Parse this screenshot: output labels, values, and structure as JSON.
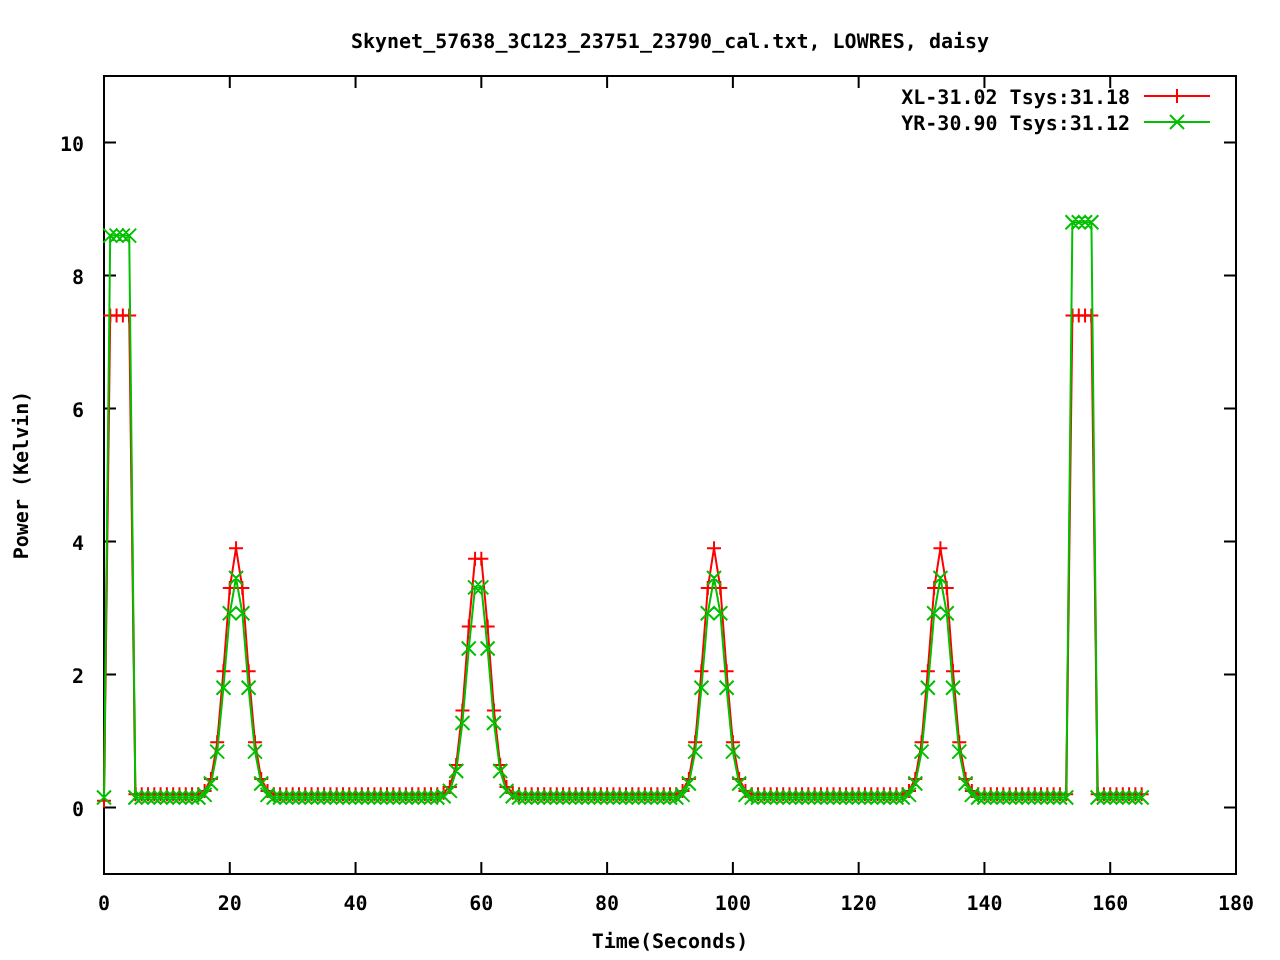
{
  "chart_data": {
    "type": "line",
    "title": "Skynet_57638_3C123_23751_23790_cal.txt, LOWRES, daisy",
    "xlabel": "Time(Seconds)",
    "ylabel": "Power (Kelvin)",
    "x": [
      0,
      1,
      2,
      3,
      4,
      5,
      6,
      7,
      8,
      9,
      10,
      11,
      12,
      13,
      14,
      15,
      16,
      17,
      18,
      19,
      20,
      21,
      22,
      23,
      24,
      25,
      26,
      27,
      28,
      29,
      30,
      31,
      32,
      33,
      34,
      35,
      36,
      37,
      38,
      39,
      40,
      41,
      42,
      43,
      44,
      45,
      46,
      47,
      48,
      49,
      50,
      51,
      52,
      53,
      54,
      55,
      56,
      57,
      58,
      59,
      60,
      61,
      62,
      63,
      64,
      65,
      66,
      67,
      68,
      69,
      70,
      71,
      72,
      73,
      74,
      75,
      76,
      77,
      78,
      79,
      80,
      81,
      82,
      83,
      84,
      85,
      86,
      87,
      88,
      89,
      90,
      91,
      92,
      93,
      94,
      95,
      96,
      97,
      98,
      99,
      100,
      101,
      102,
      103,
      104,
      105,
      106,
      107,
      108,
      109,
      110,
      111,
      112,
      113,
      114,
      115,
      116,
      117,
      118,
      119,
      120,
      121,
      122,
      123,
      124,
      125,
      126,
      127,
      128,
      129,
      130,
      131,
      132,
      133,
      134,
      135,
      136,
      137,
      138,
      139,
      140,
      141,
      142,
      143,
      144,
      145,
      146,
      147,
      148,
      149,
      150,
      151,
      152,
      153,
      154,
      155,
      156,
      157,
      158,
      159,
      160,
      161,
      162,
      163,
      164,
      165
    ],
    "series": [
      {
        "name": "XL-31.02 Tsys:31.18",
        "color": "#ff0000",
        "marker": "plus",
        "values": [
          0.1,
          7.4,
          7.4,
          7.4,
          7.4,
          0.2,
          0.2,
          0.2,
          0.2,
          0.2,
          0.2,
          0.2,
          0.2,
          0.2,
          0.2,
          0.2,
          0.25,
          0.43,
          0.98,
          2.05,
          3.3,
          3.9,
          3.3,
          2.05,
          0.98,
          0.43,
          0.25,
          0.2,
          0.2,
          0.2,
          0.2,
          0.2,
          0.2,
          0.2,
          0.2,
          0.2,
          0.2,
          0.2,
          0.2,
          0.2,
          0.2,
          0.2,
          0.2,
          0.2,
          0.2,
          0.2,
          0.2,
          0.2,
          0.2,
          0.2,
          0.2,
          0.2,
          0.2,
          0.2,
          0.22,
          0.31,
          0.64,
          1.46,
          2.72,
          3.74,
          3.74,
          2.72,
          1.46,
          0.64,
          0.31,
          0.22,
          0.2,
          0.2,
          0.2,
          0.2,
          0.2,
          0.2,
          0.2,
          0.2,
          0.2,
          0.2,
          0.2,
          0.2,
          0.2,
          0.2,
          0.2,
          0.2,
          0.2,
          0.2,
          0.2,
          0.2,
          0.2,
          0.2,
          0.2,
          0.2,
          0.2,
          0.2,
          0.25,
          0.43,
          0.98,
          2.05,
          3.3,
          3.9,
          3.3,
          2.05,
          0.98,
          0.43,
          0.25,
          0.2,
          0.2,
          0.2,
          0.2,
          0.2,
          0.2,
          0.2,
          0.2,
          0.2,
          0.2,
          0.2,
          0.2,
          0.2,
          0.2,
          0.2,
          0.2,
          0.2,
          0.2,
          0.2,
          0.2,
          0.2,
          0.2,
          0.2,
          0.2,
          0.2,
          0.25,
          0.43,
          0.98,
          2.05,
          3.3,
          3.9,
          3.3,
          2.05,
          0.98,
          0.43,
          0.25,
          0.2,
          0.2,
          0.2,
          0.2,
          0.2,
          0.2,
          0.2,
          0.2,
          0.2,
          0.2,
          0.2,
          0.2,
          0.2,
          0.2,
          0.2,
          7.4,
          7.4,
          7.4,
          7.4,
          0.2,
          0.2,
          0.2,
          0.2,
          0.2,
          0.2,
          0.2,
          0.2
        ]
      },
      {
        "name": "YR-30.90 Tsys:31.12",
        "color": "#00c000",
        "marker": "cross",
        "values": [
          0.15,
          8.6,
          8.6,
          8.6,
          8.6,
          0.15,
          0.15,
          0.15,
          0.15,
          0.15,
          0.15,
          0.15,
          0.15,
          0.15,
          0.15,
          0.15,
          0.19,
          0.36,
          0.84,
          1.8,
          2.92,
          3.45,
          2.92,
          1.8,
          0.84,
          0.36,
          0.19,
          0.15,
          0.15,
          0.15,
          0.15,
          0.15,
          0.15,
          0.15,
          0.15,
          0.15,
          0.15,
          0.15,
          0.15,
          0.15,
          0.15,
          0.15,
          0.15,
          0.15,
          0.15,
          0.15,
          0.15,
          0.15,
          0.15,
          0.15,
          0.15,
          0.15,
          0.15,
          0.15,
          0.17,
          0.25,
          0.55,
          1.27,
          2.39,
          3.31,
          3.31,
          2.39,
          1.27,
          0.55,
          0.25,
          0.17,
          0.15,
          0.15,
          0.15,
          0.15,
          0.15,
          0.15,
          0.15,
          0.15,
          0.15,
          0.15,
          0.15,
          0.15,
          0.15,
          0.15,
          0.15,
          0.15,
          0.15,
          0.15,
          0.15,
          0.15,
          0.15,
          0.15,
          0.15,
          0.15,
          0.15,
          0.15,
          0.19,
          0.36,
          0.84,
          1.8,
          2.92,
          3.45,
          2.92,
          1.8,
          0.84,
          0.36,
          0.19,
          0.15,
          0.15,
          0.15,
          0.15,
          0.15,
          0.15,
          0.15,
          0.15,
          0.15,
          0.15,
          0.15,
          0.15,
          0.15,
          0.15,
          0.15,
          0.15,
          0.15,
          0.15,
          0.15,
          0.15,
          0.15,
          0.15,
          0.15,
          0.15,
          0.15,
          0.19,
          0.36,
          0.84,
          1.8,
          2.92,
          3.45,
          2.92,
          1.8,
          0.84,
          0.36,
          0.19,
          0.15,
          0.15,
          0.15,
          0.15,
          0.15,
          0.15,
          0.15,
          0.15,
          0.15,
          0.15,
          0.15,
          0.15,
          0.15,
          0.15,
          0.15,
          8.8,
          8.8,
          8.8,
          8.8,
          0.15,
          0.15,
          0.15,
          0.15,
          0.15,
          0.15,
          0.15,
          0.15
        ]
      }
    ],
    "xlim": [
      0,
      180
    ],
    "ylim": [
      -1,
      11
    ],
    "xticks": [
      0,
      20,
      40,
      60,
      80,
      100,
      120,
      140,
      160,
      180
    ],
    "yticks": [
      0,
      2,
      4,
      6,
      8,
      10
    ],
    "legend": true
  }
}
